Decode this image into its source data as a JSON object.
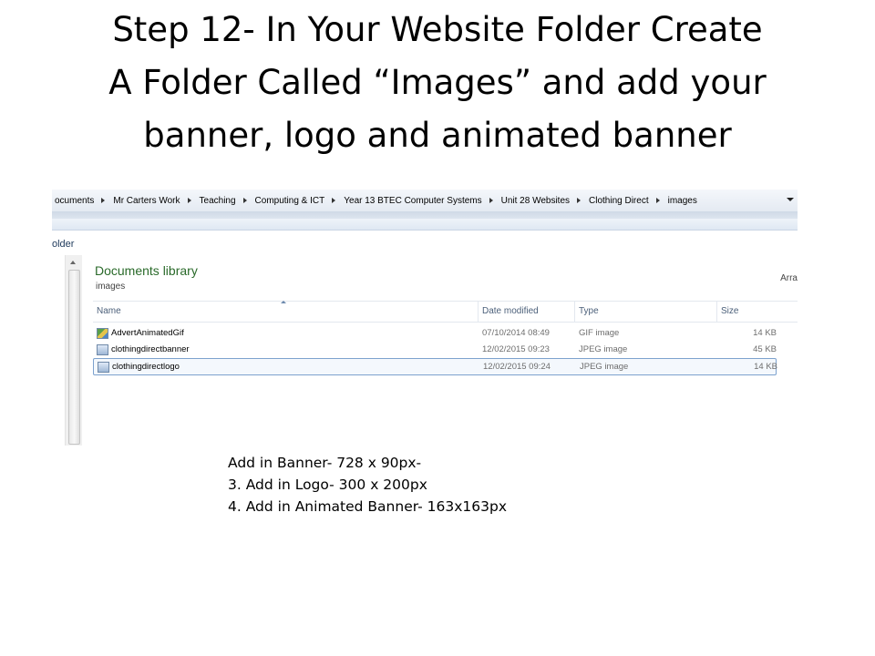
{
  "slide": {
    "title_lines": [
      "Step 12- In Your Website Folder Create",
      "A Folder Called “Images” and add your",
      "banner, logo and animated banner"
    ],
    "notes": [
      "Add in Banner- 728 x 90px-",
      "3. Add in Logo- 300 x 200px",
      "4. Add in Animated Banner- 163x163px"
    ]
  },
  "explorer": {
    "breadcrumbs": [
      "ocuments",
      "Mr Carters Work",
      "Teaching",
      "Computing & ICT",
      "Year 13 BTEC Computer Systems",
      "Unit 28 Websites",
      "Clothing Direct",
      "images"
    ],
    "nav_label": "older",
    "library_title": "Documents library",
    "library_subtitle": "images",
    "arrange_label": "Arra",
    "columns": {
      "name": "Name",
      "date": "Date modified",
      "type": "Type",
      "size": "Size"
    },
    "files": [
      {
        "name": "AdvertAnimatedGif",
        "date": "07/10/2014 08:49",
        "type": "GIF image",
        "size": "14 KB",
        "icon": "gif-image-icon"
      },
      {
        "name": "clothingdirectbanner",
        "date": "12/02/2015 09:23",
        "type": "JPEG image",
        "size": "45 KB",
        "icon": "jpeg-image-icon"
      },
      {
        "name": "clothingdirectlogo",
        "date": "12/02/2015 09:24",
        "type": "JPEG image",
        "size": "14 KB",
        "icon": "jpeg-image-icon",
        "selected": true
      }
    ]
  }
}
